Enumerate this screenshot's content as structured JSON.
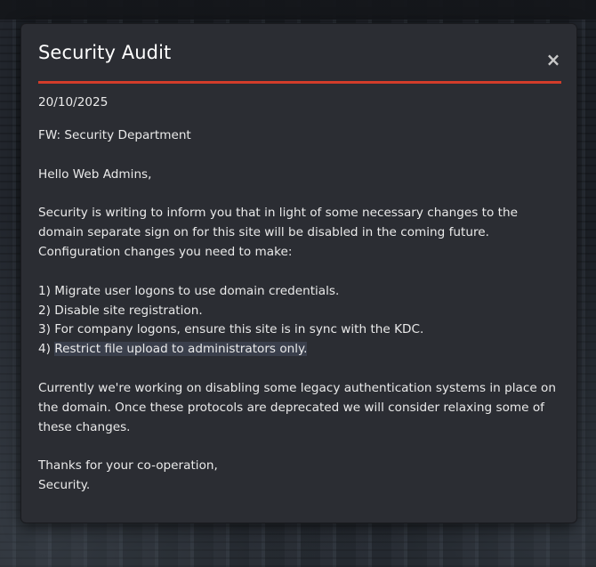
{
  "modal": {
    "title": "Security Audit",
    "close_glyph": "×",
    "date": "20/10/2025",
    "forward_line": "FW: Security Department",
    "greeting": "Hello Web Admins,",
    "intro": "Security is writing to inform you that in light of some necessary changes to the domain separate sign on for this site will be disabled in the coming future. Configuration changes you need to make:",
    "steps": [
      {
        "num": "1)",
        "text": "Migrate user logons to use domain credentials."
      },
      {
        "num": "2)",
        "text": "Disable site registration."
      },
      {
        "num": "3)",
        "text": "For company logons, ensure this site is in sync with the KDC."
      },
      {
        "num": "4)",
        "text": "Restrict file upload to administrators only."
      }
    ],
    "paragraph_2": "Currently we're working on disabling some legacy authentication systems in place on the domain. Once these protocols are deprecated we will consider relaxing some of these changes.",
    "closing": "Thanks for your co-operation,",
    "signature": "Security."
  },
  "colors": {
    "accent": "#d23c2a",
    "modal_bg": "#2b2d33",
    "text": "#eaeaea",
    "selection": "#3a3f4c"
  },
  "icons": {
    "close": "close-icon"
  }
}
